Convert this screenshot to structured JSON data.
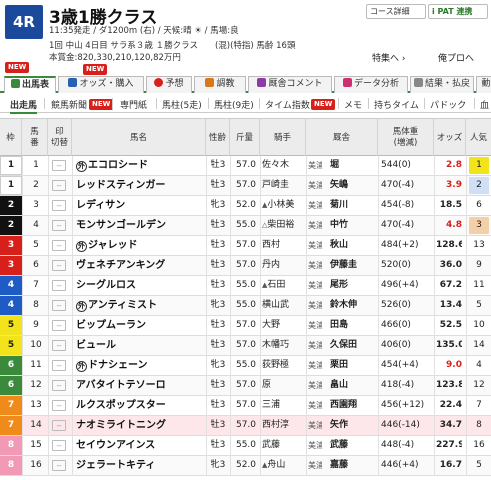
{
  "header": {
    "race_number": "4R",
    "race_name": "3歳1勝クラス",
    "conditions": "11:35発走 / ダ1200m (右) / 天候:晴 ☀ / 馬場:良",
    "info": "1回 中山 4日目 サラ系３歳 １勝クラス　　(混)(特指) 馬齢 16頭",
    "prize": "本賞金:820,330,210,120,82万円",
    "course_detail": "コース詳細",
    "ipat": "i PAT 連携",
    "tokusou": "特集へ ›",
    "my_page": "俺プロへ"
  },
  "tabs": [
    {
      "label": "出馬表",
      "icon_color": "#3b8a3b",
      "active": true
    },
    {
      "label": "オッズ・購入",
      "icon_color": "#2860b3",
      "new": true
    },
    {
      "label": "予想",
      "icon_color": "#d8201a"
    },
    {
      "label": "調教",
      "icon_color": "#d8781a"
    },
    {
      "label": "厩舎コメント",
      "icon_color": "#8c3aa8"
    },
    {
      "label": "データ分析",
      "icon_color": "#cc3070"
    },
    {
      "label": "結果・払戻",
      "icon_color": "#888888"
    },
    {
      "label": "動"
    }
  ],
  "tabs_new_badge": "NEW",
  "subnav": [
    {
      "label": "出走馬",
      "active": true
    },
    {
      "label": "競馬新聞",
      "new": true
    },
    {
      "label": "専門紙"
    },
    {
      "label": "馬柱(5走)"
    },
    {
      "label": "馬柱(9走)"
    },
    {
      "label": "タイム指数",
      "new": true
    },
    {
      "label": "メモ"
    },
    {
      "label": "持ちタイム"
    },
    {
      "label": "パドック"
    },
    {
      "label": "血"
    }
  ],
  "subnav_new_badge": "NEW",
  "columns": {
    "waku": "枠",
    "uma": "馬\n番",
    "mark": "印\n切替",
    "name": "馬名",
    "sex": "性齢",
    "kin": "斤量",
    "jockey": "騎手",
    "trainer": "厩舎",
    "weight": "馬体重\n(増減)",
    "odds": "オッズ",
    "pop": "人気"
  },
  "mark_placeholder": "--",
  "horses": [
    {
      "waku": "1",
      "waku_color": "#ffffff",
      "waku_text": "#222222",
      "uma": "1",
      "maru": "外",
      "name": "エコロシード",
      "sex": "牡3",
      "kin": "57.0",
      "jockey": "佐々木",
      "aff": "美浦",
      "trainer": "堀",
      "weight": "544(0)",
      "odds": "2.8",
      "red": true,
      "pop": "1"
    },
    {
      "waku": "1",
      "waku_color": "#ffffff",
      "waku_text": "#222222",
      "uma": "2",
      "name": "レッドスティンガー",
      "sex": "牡3",
      "kin": "57.0",
      "jockey": "戸崎圭",
      "aff": "美浦",
      "trainer": "矢嶋",
      "weight": "470(-4)",
      "odds": "3.9",
      "red": true,
      "pop": "2"
    },
    {
      "waku": "2",
      "waku_color": "#111111",
      "waku_text": "#ffffff",
      "uma": "3",
      "name": "レディサン",
      "sex": "牝3",
      "kin": "52.0",
      "jockey": "小林美",
      "sh": "▲",
      "aff": "美浦",
      "trainer": "菊川",
      "weight": "454(-8)",
      "odds": "18.5",
      "pop": "6"
    },
    {
      "waku": "2",
      "waku_color": "#111111",
      "waku_text": "#ffffff",
      "uma": "4",
      "name": "モンサンゴールデン",
      "sex": "牡3",
      "kin": "55.0",
      "jockey": "柴田裕",
      "sh": "△",
      "aff": "美浦",
      "trainer": "中竹",
      "weight": "470(-4)",
      "odds": "4.8",
      "red": true,
      "pop": "3"
    },
    {
      "waku": "3",
      "waku_color": "#d8201a",
      "waku_text": "#ffffff",
      "uma": "5",
      "maru": "外",
      "name": "ジャレッド",
      "sex": "牡3",
      "kin": "57.0",
      "jockey": "西村",
      "aff": "美浦",
      "trainer": "秋山",
      "weight": "484(+2)",
      "odds": "128.6",
      "pop": "13"
    },
    {
      "waku": "3",
      "waku_color": "#d8201a",
      "waku_text": "#ffffff",
      "uma": "6",
      "name": "ヴェネチアンキング",
      "sex": "牡3",
      "kin": "57.0",
      "jockey": "丹内",
      "aff": "美浦",
      "trainer": "伊藤圭",
      "weight": "520(0)",
      "odds": "36.0",
      "pop": "9"
    },
    {
      "waku": "4",
      "waku_color": "#1f5bc4",
      "waku_text": "#ffffff",
      "uma": "7",
      "name": "シーグルロス",
      "sex": "牡3",
      "kin": "55.0",
      "jockey": "石田",
      "sh": "▲",
      "aff": "美浦",
      "trainer": "尾形",
      "weight": "496(+4)",
      "odds": "67.2",
      "pop": "11"
    },
    {
      "waku": "4",
      "waku_color": "#1f5bc4",
      "waku_text": "#ffffff",
      "uma": "8",
      "maru": "外",
      "name": "アンティミスト",
      "sex": "牝3",
      "kin": "55.0",
      "jockey": "横山武",
      "aff": "美浦",
      "trainer": "鈴木伸",
      "weight": "526(0)",
      "odds": "13.4",
      "pop": "5"
    },
    {
      "waku": "5",
      "waku_color": "#f2e31a",
      "waku_text": "#222222",
      "uma": "9",
      "name": "ビップムーラン",
      "sex": "牡3",
      "kin": "57.0",
      "jockey": "大野",
      "aff": "美浦",
      "trainer": "田島",
      "weight": "466(0)",
      "odds": "52.5",
      "pop": "10"
    },
    {
      "waku": "5",
      "waku_color": "#f2e31a",
      "waku_text": "#222222",
      "uma": "10",
      "name": "ビュール",
      "sex": "牡3",
      "kin": "57.0",
      "jockey": "木幡巧",
      "aff": "美浦",
      "trainer": "久保田",
      "weight": "406(0)",
      "odds": "135.0",
      "pop": "14"
    },
    {
      "waku": "6",
      "waku_color": "#3b8a3b",
      "waku_text": "#ffffff",
      "uma": "11",
      "maru": "外",
      "name": "ドナシェーン",
      "sex": "牝3",
      "kin": "55.0",
      "jockey": "荻野極",
      "aff": "美浦",
      "trainer": "栗田",
      "weight": "454(+4)",
      "odds": "9.0",
      "red": true,
      "pop": "4"
    },
    {
      "waku": "6",
      "waku_color": "#3b8a3b",
      "waku_text": "#ffffff",
      "uma": "12",
      "name": "アバタイトテソーロ",
      "sex": "牡3",
      "kin": "57.0",
      "jockey": "原",
      "aff": "美浦",
      "trainer": "畠山",
      "weight": "418(-4)",
      "odds": "123.8",
      "pop": "12"
    },
    {
      "waku": "7",
      "waku_color": "#f08a1a",
      "waku_text": "#ffffff",
      "uma": "13",
      "name": "ルクスポップスター",
      "sex": "牡3",
      "kin": "57.0",
      "jockey": "三浦",
      "aff": "美浦",
      "trainer": "西園翔",
      "weight": "456(+12)",
      "odds": "22.4",
      "pop": "7"
    },
    {
      "waku": "7",
      "waku_color": "#f08a1a",
      "waku_text": "#ffffff",
      "uma": "14",
      "name": "ナオミライトニング",
      "sex": "牡3",
      "kin": "57.0",
      "jockey": "西村淳",
      "aff": "美浦",
      "trainer": "矢作",
      "weight": "446(-14)",
      "odds": "34.7",
      "pop": "8",
      "highlight": true
    },
    {
      "waku": "8",
      "waku_color": "#f29ab5",
      "waku_text": "#ffffff",
      "uma": "15",
      "name": "セイウンアインス",
      "sex": "牡3",
      "kin": "55.0",
      "jockey": "武藤",
      "aff": "美浦",
      "trainer": "武藤",
      "weight": "448(-4)",
      "odds": "227.9",
      "pop": "16"
    },
    {
      "waku": "8",
      "waku_color": "#f29ab5",
      "waku_text": "#ffffff",
      "uma": "16",
      "name": "ジェラートキティ",
      "sex": "牝3",
      "kin": "52.0",
      "jockey": "舟山",
      "sh": "▲",
      "aff": "美浦",
      "trainer": "嘉藤",
      "weight": "446(+4)",
      "odds": "16.7",
      "pop": "5"
    }
  ]
}
